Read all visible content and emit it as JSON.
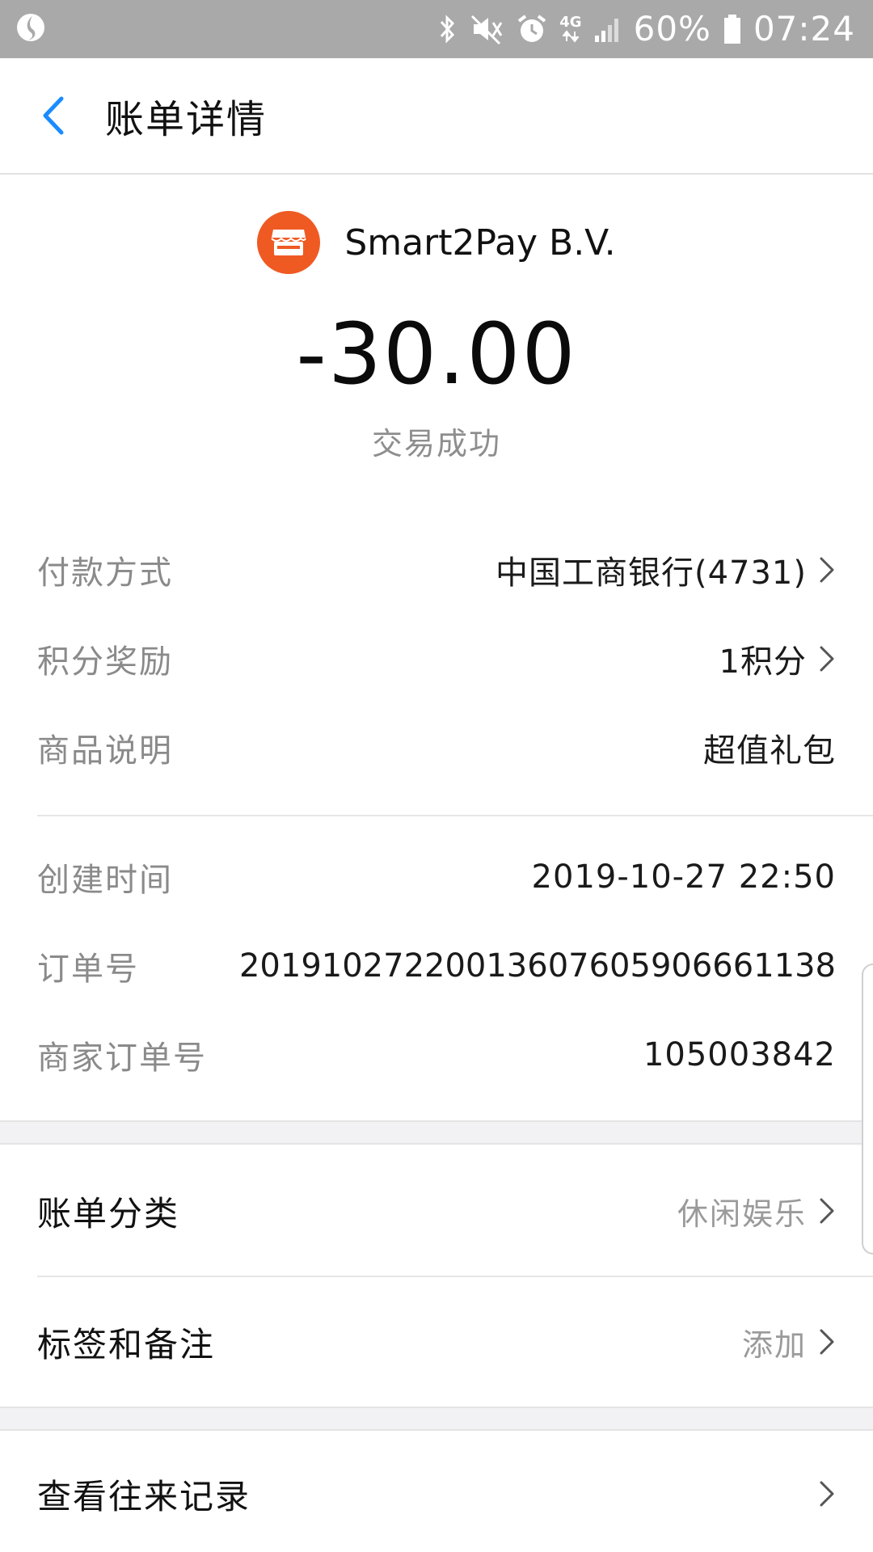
{
  "status_bar": {
    "network": "4G",
    "battery": "60%",
    "time": "07:24"
  },
  "header": {
    "title": "账单详情"
  },
  "summary": {
    "merchant_name": "Smart2Pay B.V.",
    "amount": "-30.00",
    "status": "交易成功"
  },
  "details": [
    {
      "label": "付款方式",
      "value": "中国工商银行(4731)"
    },
    {
      "label": "积分奖励",
      "value": "1积分"
    },
    {
      "label": "商品说明",
      "value": "超值礼包"
    },
    {
      "label": "创建时间",
      "value": "2019-10-27 22:50"
    },
    {
      "label": "订单号",
      "value": "20191027220013607605906661138"
    },
    {
      "label": "商家订单号",
      "value": "105003842"
    }
  ],
  "bill_category": {
    "label": "账单分类",
    "value": "休闲娱乐"
  },
  "tags_notes": {
    "label": "标签和备注",
    "value": "添加"
  },
  "history": {
    "label": "查看往来记录"
  },
  "colors": {
    "accent_blue": "#1a8cff",
    "merchant_orange": "#ef5a23",
    "status_bar": "#a9a9a9"
  }
}
